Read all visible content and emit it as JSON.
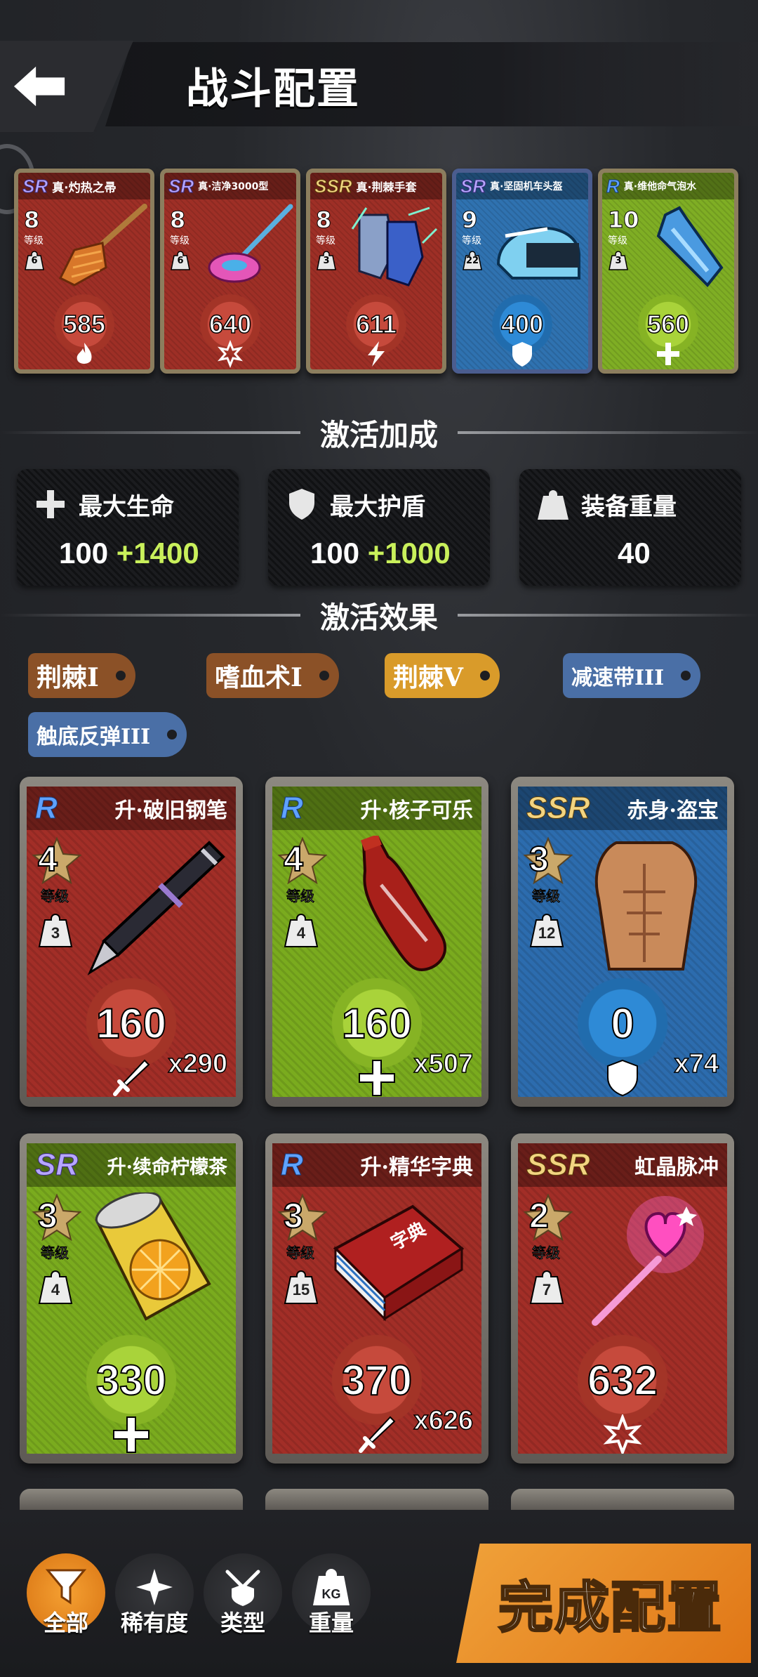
{
  "header": {
    "title": "战斗配置"
  },
  "equipped": [
    {
      "rarity": "SR",
      "name": "真·灼热之帚",
      "level": "8",
      "level_label": "等级",
      "weight": "6",
      "value": "585",
      "stat_icon": "fire-icon",
      "color": "red"
    },
    {
      "rarity": "SR",
      "name": "真·洁净3000型",
      "level": "8",
      "level_label": "等级",
      "weight": "6",
      "value": "640",
      "stat_icon": "snowflake-icon",
      "color": "red"
    },
    {
      "rarity": "SSR",
      "name": "真·荆棘手套",
      "level": "8",
      "level_label": "等级",
      "weight": "3",
      "value": "611",
      "stat_icon": "lightning-icon",
      "color": "red"
    },
    {
      "rarity": "SR",
      "name": "真·坚固机车头盔",
      "level": "9",
      "level_label": "等级",
      "weight": "22",
      "value": "400",
      "stat_icon": "shield-icon",
      "color": "blue"
    },
    {
      "rarity": "R",
      "name": "真·维他命气泡水",
      "level": "10",
      "level_label": "等级",
      "weight": "3",
      "value": "560",
      "stat_icon": "plus-icon",
      "color": "green"
    }
  ],
  "bonus_section": {
    "title": "激活加成"
  },
  "bonuses": [
    {
      "label": "最大生命",
      "base": "100",
      "plus": "+1400",
      "icon": "plus-icon"
    },
    {
      "label": "最大护盾",
      "base": "100",
      "plus": "+1000",
      "icon": "shield-icon"
    },
    {
      "label": "装备重量",
      "base": "40",
      "plus": "",
      "icon": "weight-icon"
    }
  ],
  "effect_section": {
    "title": "激活效果"
  },
  "effects": [
    {
      "label": "荆棘I",
      "color": "#8b5127"
    },
    {
      "label": "嗜血术I",
      "color": "#8b5127"
    },
    {
      "label": "荆棘V",
      "color": "#d99b2a"
    },
    {
      "label": "减速带III",
      "color": "#4a6fa6"
    },
    {
      "label": "触底反弹III",
      "color": "#4a6fa6"
    }
  ],
  "inventory": [
    {
      "rarity": "R",
      "name": "升·破旧钢笔",
      "level": "4",
      "level_label": "等级",
      "weight": "3",
      "value": "160",
      "count": "x290",
      "stat_icon": "sword-icon",
      "color": "red",
      "art": "pen-icon"
    },
    {
      "rarity": "R",
      "name": "升·核子可乐",
      "level": "4",
      "level_label": "等级",
      "weight": "4",
      "value": "160",
      "count": "x507",
      "stat_icon": "plus-icon",
      "color": "green",
      "art": "cola-bottle-icon"
    },
    {
      "rarity": "SSR",
      "name": "赤身·盗宝",
      "level": "3",
      "level_label": "等级",
      "weight": "12",
      "value": "0",
      "count": "x74",
      "stat_icon": "shield-icon",
      "color": "blue",
      "art": "torso-icon"
    },
    {
      "rarity": "SR",
      "name": "升·续命柠檬茶",
      "level": "3",
      "level_label": "等级",
      "weight": "4",
      "value": "330",
      "count": "",
      "stat_icon": "plus-icon",
      "color": "green",
      "art": "lemon-tea-can-icon"
    },
    {
      "rarity": "R",
      "name": "升·精华字典",
      "level": "3",
      "level_label": "等级",
      "weight": "15",
      "value": "370",
      "count": "x626",
      "stat_icon": "sword-icon",
      "color": "red",
      "art": "dictionary-icon"
    },
    {
      "rarity": "SSR",
      "name": "虹晶脉冲",
      "level": "2",
      "level_label": "等级",
      "weight": "7",
      "value": "632",
      "count": "",
      "stat_icon": "snowflake-icon",
      "color": "red",
      "art": "heart-wand-icon"
    }
  ],
  "dictionary_text": "字典",
  "filters": [
    {
      "label": "全部",
      "icon": "funnel-icon",
      "active": true
    },
    {
      "label": "稀有度",
      "icon": "sparkle-icon",
      "active": false
    },
    {
      "label": "类型",
      "icon": "crossed-swords-shield-icon",
      "active": false
    },
    {
      "label": "重量",
      "icon": "kg-weight-icon",
      "active": false,
      "icon_text": "KG"
    }
  ],
  "confirm_label": "完成配置"
}
